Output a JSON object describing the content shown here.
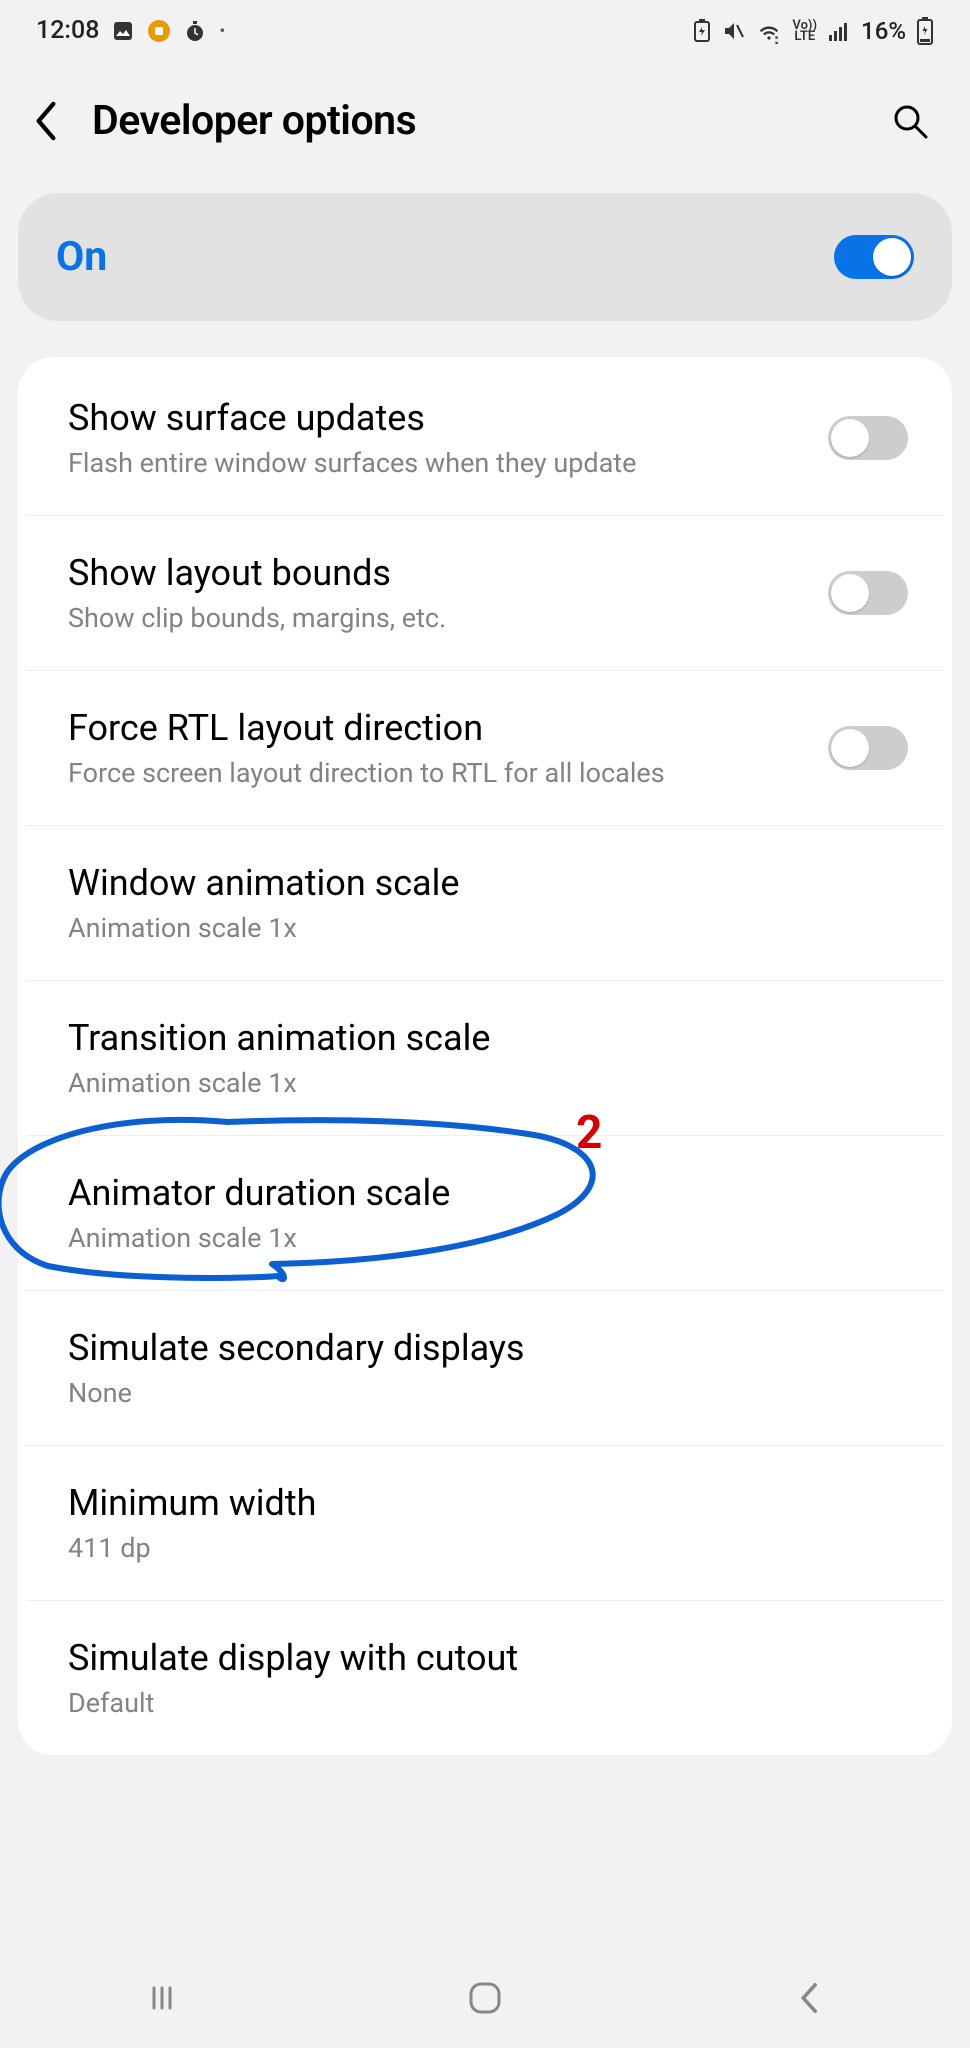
{
  "statusbar": {
    "time": "12:08",
    "battery_percent": "16%",
    "lte_label": "Vo))\nLTE"
  },
  "header": {
    "title": "Developer options"
  },
  "master": {
    "label": "On",
    "state": true
  },
  "settings": [
    {
      "title": "Show surface updates",
      "sub": "Flash entire window surfaces when they update",
      "toggle": true,
      "on": false
    },
    {
      "title": "Show layout bounds",
      "sub": "Show clip bounds, margins, etc.",
      "toggle": true,
      "on": false
    },
    {
      "title": "Force RTL layout direction",
      "sub": "Force screen layout direction to RTL for all locales",
      "toggle": true,
      "on": false
    },
    {
      "title": "Window animation scale",
      "sub": "Animation scale 1x",
      "toggle": false
    },
    {
      "title": "Transition animation scale",
      "sub": "Animation scale 1x",
      "toggle": false
    },
    {
      "title": "Animator duration scale",
      "sub": "Animation scale 1x",
      "toggle": false
    },
    {
      "title": "Simulate secondary displays",
      "sub": "None",
      "toggle": false
    },
    {
      "title": "Minimum width",
      "sub": "411 dp",
      "toggle": false
    },
    {
      "title": "Simulate display with cutout",
      "sub": "Default",
      "toggle": false
    }
  ],
  "annotation": {
    "number": "2"
  }
}
